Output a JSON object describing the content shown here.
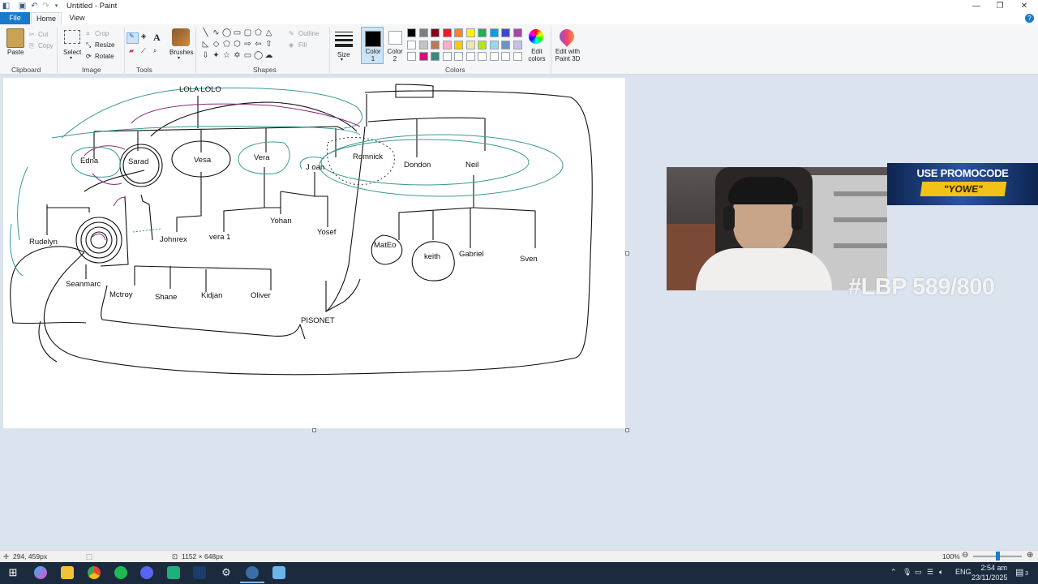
{
  "window": {
    "title": "Untitled - Paint",
    "min_icon": "minimize-icon",
    "max_icon": "restore-icon",
    "close_icon": "close-icon"
  },
  "menu": {
    "file": "File",
    "tabs": [
      "Home",
      "View"
    ]
  },
  "ribbon": {
    "clipboard": {
      "paste": "Paste",
      "cut": "Cut",
      "copy": "Copy",
      "label": "Clipboard"
    },
    "image": {
      "select": "Select",
      "crop": "Crop",
      "resize": "Resize",
      "rotate": "Rotate",
      "label": "Image"
    },
    "tools": {
      "label": "Tools"
    },
    "brushes": {
      "label": "Brushes"
    },
    "shapes": {
      "outline": "Outline",
      "fill": "Fill",
      "label": "Shapes"
    },
    "size": {
      "label": "Size"
    },
    "color1": {
      "label": "Color 1"
    },
    "color2": {
      "label": "Color 2"
    },
    "colors": {
      "edit": "Edit colors",
      "label": "Colors",
      "row1": [
        "#000000",
        "#7f7f7f",
        "#880015",
        "#ed1c24",
        "#ff7f27",
        "#fff200",
        "#22b14c",
        "#00a2e8",
        "#3f48cc",
        "#a349a4"
      ],
      "row2": [
        "#ffffff",
        "#c3c3c3",
        "#b97a57",
        "#ffaec9",
        "#ffc90e",
        "#efe4b0",
        "#b5e61d",
        "#99d9ea",
        "#7092be",
        "#c8bfe7"
      ],
      "row3": [
        "#ffffff",
        "#e0087a",
        "#3b8a7c",
        "#ffffff",
        "#ffffff",
        "#ffffff",
        "#ffffff",
        "#ffffff",
        "#ffffff",
        "#ffffff"
      ]
    },
    "paint3d": "Edit with Paint 3D"
  },
  "drawing": {
    "labels": [
      {
        "text": "LOLA LOLO"
      },
      {
        "text": "Edna"
      },
      {
        "text": "Sarad"
      },
      {
        "text": "Vesa"
      },
      {
        "text": "Vera"
      },
      {
        "text": "J oan"
      },
      {
        "text": "Romnick"
      },
      {
        "text": "Dondon"
      },
      {
        "text": "Neil"
      },
      {
        "text": "Rudelyn"
      },
      {
        "text": "Johnrex"
      },
      {
        "text": "vera 1"
      },
      {
        "text": "Yohan"
      },
      {
        "text": "Yosef"
      },
      {
        "text": "MatEo"
      },
      {
        "text": "keith"
      },
      {
        "text": "Gabriel"
      },
      {
        "text": "Sven"
      },
      {
        "text": "Seanmarc"
      },
      {
        "text": "Mctroy"
      },
      {
        "text": "Shane"
      },
      {
        "text": "Kidjan"
      },
      {
        "text": "Oliver"
      },
      {
        "text": "PISONET"
      }
    ]
  },
  "overlay": {
    "promo_line1": "USE PROMOCODE",
    "promo_line2": "\"YOWE\"",
    "counter": "#LBP 589/800"
  },
  "status": {
    "cursor_pos": "294, 459px",
    "canvas_size": "1152 × 648px",
    "zoom": "100%"
  },
  "taskbar": {
    "apps": [
      "windows-start-icon",
      "copilot-icon",
      "file-explorer-icon",
      "chrome-icon",
      "spotify-icon",
      "discord-icon",
      "app-icon",
      "steam-icon",
      "settings-icon",
      "browser-icon",
      "paint-icon"
    ],
    "lang": "ENG",
    "time": "2:54 am",
    "date": "23/11/2025",
    "notifications": "3"
  }
}
